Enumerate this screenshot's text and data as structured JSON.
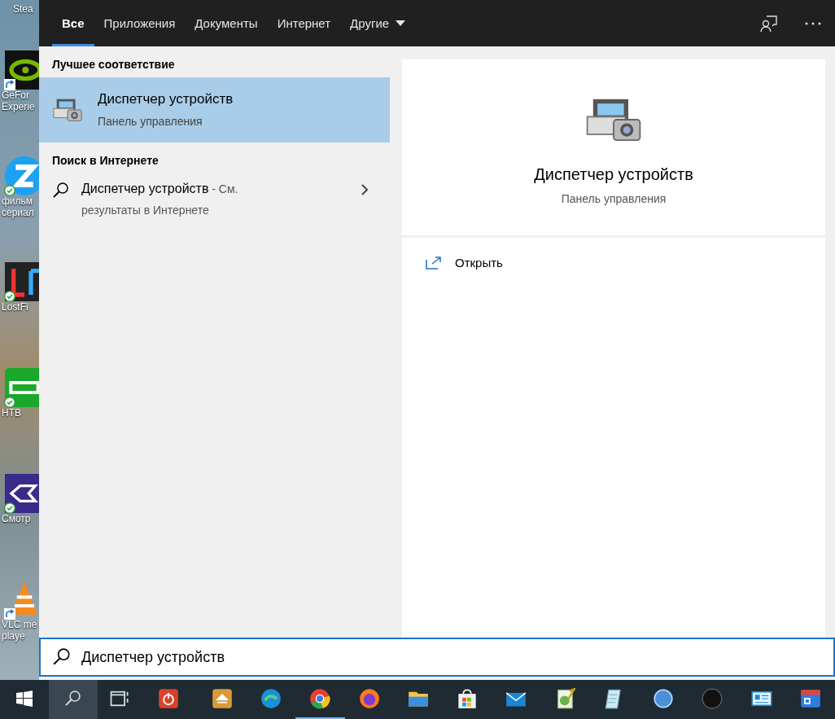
{
  "desktop_icons": [
    {
      "labels": [
        "Stea"
      ]
    },
    {
      "kind": "nvidia",
      "labels": [
        "GeFor",
        "Experie"
      ],
      "shortcut": true,
      "synced": false
    },
    {
      "kind": "zetflix",
      "labels": [
        "фильм",
        "сериал"
      ],
      "shortcut": false,
      "synced": true
    },
    {
      "kind": "lostfilm",
      "labels": [
        "LostFi"
      ],
      "shortcut": false,
      "synced": true
    },
    {
      "kind": "ntv",
      "labels": [
        "НТВ"
      ],
      "shortcut": false,
      "synced": true
    },
    {
      "kind": "smotrim",
      "labels": [
        "Смотр"
      ],
      "shortcut": false,
      "synced": true
    },
    {
      "kind": "vlc",
      "labels": [
        "VLC me",
        "playe"
      ],
      "shortcut": true,
      "synced": false
    }
  ],
  "tabs": [
    {
      "label": "Все",
      "selected": true
    },
    {
      "label": "Приложения",
      "selected": false
    },
    {
      "label": "Документы",
      "selected": false
    },
    {
      "label": "Интернет",
      "selected": false
    },
    {
      "label": "Другие",
      "selected": false,
      "dropdown": true
    }
  ],
  "best_match": {
    "heading": "Лучшее соответствие",
    "title": "Диспетчер устройств",
    "subtitle": "Панель управления",
    "selected": true
  },
  "web_search": {
    "heading": "Поиск в Интернете",
    "text": "Диспетчер устройств",
    "suffix": " - См. результаты в Интернете"
  },
  "preview": {
    "title": "Диспетчер устройств",
    "subtitle": "Панель управления",
    "actions": [
      {
        "label": "Открыть"
      }
    ]
  },
  "search_box": {
    "value": "Диспетчер устройств"
  },
  "taskbar": {
    "search_active": true,
    "apps": [
      {
        "kind": "taskview",
        "running": false
      },
      {
        "kind": "power",
        "running": false
      },
      {
        "kind": "archive",
        "running": false
      },
      {
        "kind": "edge",
        "running": false
      },
      {
        "kind": "chrome",
        "running": true
      },
      {
        "kind": "firefox",
        "running": false
      },
      {
        "kind": "folder",
        "running": false
      },
      {
        "kind": "store",
        "running": false
      },
      {
        "kind": "mail",
        "running": false
      },
      {
        "kind": "notepadpp",
        "running": false
      },
      {
        "kind": "notes",
        "running": false
      },
      {
        "kind": "qbittorrent",
        "running": false
      },
      {
        "kind": "circle",
        "running": false
      },
      {
        "kind": "card",
        "running": false
      },
      {
        "kind": "translate",
        "running": false
      }
    ]
  }
}
